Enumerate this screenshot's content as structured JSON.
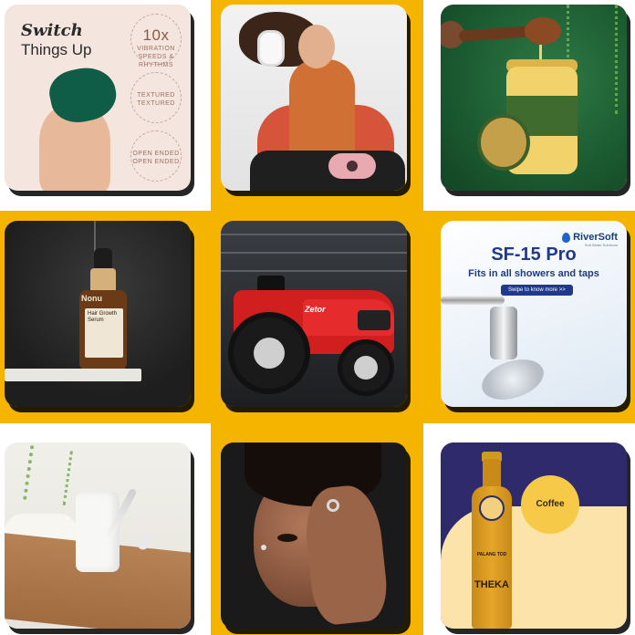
{
  "tiles": {
    "t1": {
      "headline_script": "Switch",
      "headline": "Things Up",
      "badge1_big": "10x",
      "badge1_text": "VIBRATION SPEEDS & RHYTHMS",
      "badge2_text": "TEXTURED TEXTURED",
      "badge3_text": "OPEN ENDED OPEN ENDED"
    },
    "t4": {
      "brand": "Nonu",
      "label": "Hair Growth Serum"
    },
    "t5": {
      "brand": "Zetor"
    },
    "t6": {
      "logo": "RiverSoft",
      "logo_tagline": "Soft Water Solutions",
      "title": "SF-15 Pro",
      "tagline": "Fits in all showers and taps",
      "cta": "Swipe to know more >>"
    },
    "t9": {
      "flavor": "Coffee",
      "brand_small": "PALANG TOD",
      "brand_big": "THEKA"
    }
  }
}
